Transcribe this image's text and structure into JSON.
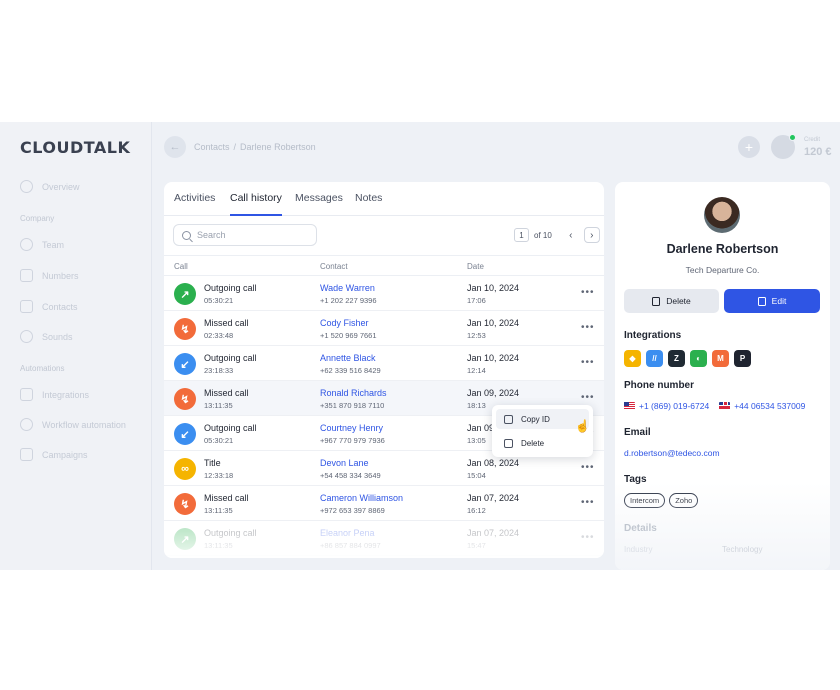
{
  "app": {
    "logo": "CLOUDTALK"
  },
  "sidebar": {
    "items": [
      {
        "label": "Overview",
        "icon": "chart-pie-icon"
      }
    ],
    "groups": [
      {
        "title": "Company",
        "items": [
          {
            "label": "Team",
            "icon": "team-icon"
          },
          {
            "label": "Numbers",
            "icon": "numbers-icon"
          },
          {
            "label": "Contacts",
            "icon": "contacts-icon"
          },
          {
            "label": "Sounds",
            "icon": "microphone-icon"
          }
        ]
      },
      {
        "title": "Automations",
        "items": [
          {
            "label": "Integrations",
            "icon": "integrations-icon"
          },
          {
            "label": "Workflow automation",
            "icon": "workflow-icon"
          },
          {
            "label": "Campaigns",
            "icon": "megaphone-icon"
          }
        ]
      }
    ]
  },
  "topbar": {
    "breadcrumb": [
      "Contacts",
      "Darlene Robertson"
    ],
    "credit_label": "Credit",
    "credit_value": "120 €"
  },
  "main": {
    "tabs": [
      "Activities",
      "Call history",
      "Messages",
      "Notes"
    ],
    "active_tab": "Call history",
    "search_placeholder": "Search",
    "pager": {
      "current": "1",
      "total_text": "of 10"
    },
    "columns": [
      "Call",
      "Contact",
      "Date"
    ],
    "rows": [
      {
        "type": "Outgoing call",
        "duration": "05:30:21",
        "name": "Wade Warren",
        "phone": "+1 202 227 9396",
        "date": "Jan 10, 2024",
        "time": "17:06",
        "kind": "outgoing"
      },
      {
        "type": "Missed call",
        "duration": "02:33:48",
        "name": "Cody Fisher",
        "phone": "+1 520 969 7661",
        "date": "Jan 10, 2024",
        "time": "12:53",
        "kind": "missed"
      },
      {
        "type": "Outgoing call",
        "duration": "23:18:33",
        "name": "Annette Black",
        "phone": "+62 339 516 8429",
        "date": "Jan 10, 2024",
        "time": "12:14",
        "kind": "incoming"
      },
      {
        "type": "Missed call",
        "duration": "13:11:35",
        "name": "Ronald Richards",
        "phone": "+351 870 918 7110",
        "date": "Jan 09, 2024",
        "time": "18:13",
        "kind": "missed"
      },
      {
        "type": "Outgoing call",
        "duration": "05:30:21",
        "name": "Courtney Henry",
        "phone": "+967 770 979 7936",
        "date": "Jan 09",
        "time": "13:05",
        "kind": "incoming"
      },
      {
        "type": "Title",
        "duration": "12:33:18",
        "name": "Devon Lane",
        "phone": "+54 458 334 3649",
        "date": "Jan 08, 2024",
        "time": "15:04",
        "kind": "voicemail"
      },
      {
        "type": "Missed call",
        "duration": "13:11:35",
        "name": "Cameron Williamson",
        "phone": "+972 653 397 8869",
        "date": "Jan 07, 2024",
        "time": "16:12",
        "kind": "missed"
      },
      {
        "type": "Outgoing call",
        "duration": "13:11:35",
        "name": "Eleanor Pena",
        "phone": "+86 857 884 0997",
        "date": "Jan 07, 2024",
        "time": "15:47",
        "kind": "outgoing"
      }
    ],
    "context_menu": [
      "Copy ID",
      "Delete"
    ]
  },
  "colors": {
    "accent": "#2f55e4",
    "outgoing": "#2bb04e",
    "missed": "#f26b3a",
    "incoming": "#3b8ef0",
    "voicemail": "#f5b400"
  },
  "profile": {
    "name": "Darlene Robertson",
    "company": "Tech Departure Co.",
    "delete_label": "Delete",
    "edit_label": "Edit",
    "integrations_title": "Integrations",
    "integrations": [
      {
        "icon": "integration-1-icon",
        "glyph": "◆",
        "color": "#f5b400"
      },
      {
        "icon": "integration-2-icon",
        "glyph": "//",
        "color": "#3b8ef0"
      },
      {
        "icon": "zendesk-icon",
        "glyph": "Z",
        "color": "#1f2a33"
      },
      {
        "icon": "freshdesk-icon",
        "glyph": "◐",
        "color": "#2bb04e"
      },
      {
        "icon": "magento-icon",
        "glyph": "M",
        "color": "#f26b3a"
      },
      {
        "icon": "pipedrive-icon",
        "glyph": "P",
        "color": "#1f2430"
      }
    ],
    "phone_title": "Phone number",
    "phones": [
      "+1 (869) 019-6724",
      "+44 06534 537009"
    ],
    "email_title": "Email",
    "email": "d.robertson@tedeco.com",
    "tags_title": "Tags",
    "tags": [
      "Intercom",
      "Zoho"
    ],
    "details_title": "Details",
    "details": {
      "key": "Industry",
      "value": "Technology"
    }
  }
}
